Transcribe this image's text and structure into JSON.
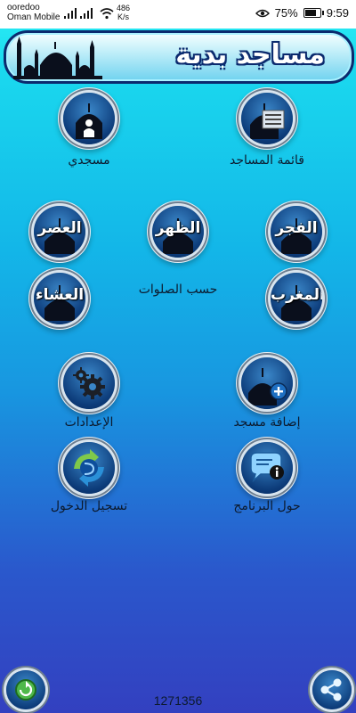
{
  "status_bar": {
    "carrier_1": "ooredoo",
    "carrier_2": "Oman Mobile",
    "net_speed_value": "486",
    "net_speed_unit": "K/s",
    "battery": "75%",
    "time": "9:59"
  },
  "header": {
    "title": "مساجد بدية"
  },
  "menu": {
    "my_mosque": "مسجدي",
    "mosques_list": "قائمة المساجد",
    "by_prayers": "حسب الصلوات",
    "settings": "الإعدادات",
    "add_mosque": "إضافة مسجد",
    "login": "تسجيل الدخول",
    "about": "حول البرنامج"
  },
  "prayers": {
    "fajr": "الفجر",
    "dhuhr": "الظهر",
    "asr": "العصر",
    "maghrib": "المغرب",
    "isha": "العشاء"
  },
  "footer": {
    "counter": "1271356"
  },
  "colors": {
    "accent": "#0c3b79",
    "background_top": "#2cf0f5",
    "background_bottom": "#3340c0"
  },
  "icons": [
    "eye-icon",
    "battery-icon",
    "mosque-icon",
    "user-icon",
    "list-icon",
    "gear-icon",
    "plus-icon",
    "sync-icon",
    "info-chat-icon",
    "refresh-icon",
    "share-icon"
  ]
}
